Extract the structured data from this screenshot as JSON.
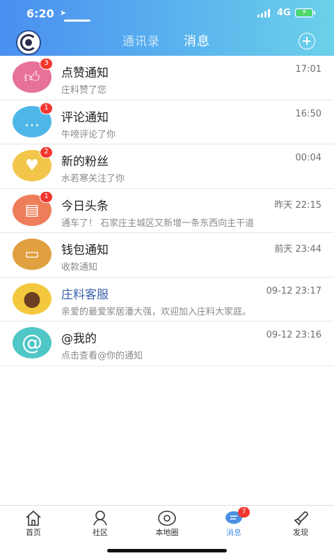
{
  "status_bar": {
    "time": "6:20",
    "network": "4G"
  },
  "header": {
    "tabs": [
      {
        "label": "通讯录",
        "active": false
      },
      {
        "label": "消息",
        "active": true
      }
    ]
  },
  "messages": [
    {
      "title": "点赞通知",
      "subtitle": "庄料赞了您",
      "time": "17:01",
      "badge": "3",
      "icon": "thumbs-up-icon",
      "color": "#e8719a"
    },
    {
      "title": "评论通知",
      "subtitle": "牛嗙评论了你",
      "time": "16:50",
      "badge": "1",
      "icon": "chat-bubble-icon",
      "color": "#4fb7e8"
    },
    {
      "title": "新的粉丝",
      "subtitle": "水若寒关注了你",
      "time": "00:04",
      "badge": "2",
      "icon": "user-heart-icon",
      "color": "#f2c64a"
    },
    {
      "title": "今日头条",
      "subtitle": "通车了！ 石家庄主城区又新增一条东西向主干道",
      "time": "昨天 22:15",
      "badge": "1",
      "icon": "newspaper-icon",
      "color": "#ee7d5a"
    },
    {
      "title": "钱包通知",
      "subtitle": "收款通知",
      "time": "前天 23:44",
      "badge": "",
      "icon": "wallet-icon",
      "color": "#e0a040"
    },
    {
      "title": "庄料客服",
      "subtitle": "亲爱的最爱家居潘大强，欢迎加入庄料大家庭。",
      "time": "09-12 23:17",
      "badge": "",
      "icon": "bear-avatar-icon",
      "color": "#f3c83c"
    },
    {
      "title": "@我的",
      "subtitle": "点击查看@你的通知",
      "time": "09-12 23:16",
      "badge": "",
      "icon": "at-sign-icon",
      "color": "#50c6c6"
    }
  ],
  "tab_bar": {
    "items": [
      {
        "label": "首页",
        "icon": "home-icon",
        "active": false
      },
      {
        "label": "社区",
        "icon": "community-icon",
        "active": false
      },
      {
        "label": "本地圈",
        "icon": "local-circle-icon",
        "active": false
      },
      {
        "label": "消息",
        "icon": "message-icon",
        "active": true,
        "badge": "7"
      },
      {
        "label": "发现",
        "icon": "rocket-icon",
        "active": false
      }
    ]
  }
}
